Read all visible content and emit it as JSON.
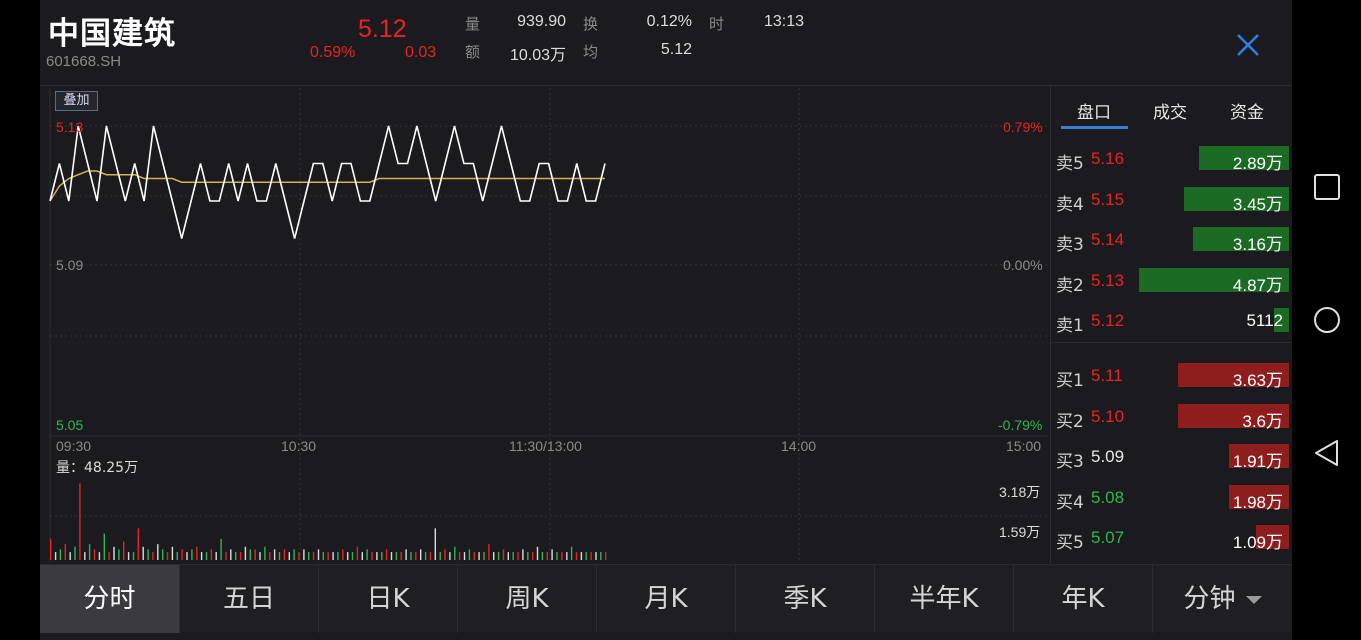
{
  "header": {
    "name": "中国建筑",
    "code": "601668.SH",
    "price": "5.12",
    "change_pct": "0.59%",
    "change": "0.03",
    "stats": [
      {
        "label": "量",
        "value": "939.90"
      },
      {
        "label": "换",
        "value": "0.12%"
      },
      {
        "label": "时",
        "value": "13:13"
      },
      {
        "label": "额",
        "value": "10.03万"
      },
      {
        "label": "均",
        "value": "5.12"
      }
    ]
  },
  "chart": {
    "overlay_label": "叠加",
    "price_high": "5.13",
    "price_mid": "5.09",
    "price_low": "5.05",
    "pct_high": "0.79%",
    "pct_mid": "0.00%",
    "pct_low": "-0.79%",
    "time_labels": [
      "09:30",
      "10:30",
      "11:30/13:00",
      "14:00",
      "15:00"
    ],
    "volume_label": "量：48.25万",
    "volume_axis_high": "3.18万",
    "volume_axis_mid": "1.59万",
    "colors": {
      "price_line": "#ffffff",
      "avg_line": "#d7b24a",
      "up": "#e8231f",
      "down": "#2fb84a"
    }
  },
  "chart_data": {
    "type": "line",
    "title": "",
    "xlabel": "",
    "ylabel": "",
    "ylim": [
      5.05,
      5.13
    ],
    "series": [
      {
        "values": [
          5.11,
          5.12,
          5.11,
          5.13,
          5.12,
          5.11,
          5.13,
          5.12,
          5.11,
          5.12,
          5.11,
          5.13,
          5.12,
          5.11,
          5.1,
          5.11,
          5.12,
          5.11,
          5.11,
          5.12,
          5.11,
          5.12,
          5.11,
          5.11,
          5.12,
          5.11,
          5.1,
          5.11,
          5.12,
          5.12,
          5.11,
          5.12,
          5.12,
          5.11,
          5.11,
          5.12,
          5.13,
          5.12,
          5.12,
          5.13,
          5.12,
          5.11,
          5.12,
          5.13,
          5.12,
          5.12,
          5.11,
          5.12,
          5.13,
          5.12,
          5.11,
          5.11,
          5.12,
          5.12,
          5.11,
          5.11,
          5.12,
          5.11,
          5.11,
          5.12
        ]
      },
      {
        "values": [
          5.11,
          5.114,
          5.116,
          5.117,
          5.118,
          5.118,
          5.117,
          5.117,
          5.117,
          5.117,
          5.116,
          5.116,
          5.116,
          5.116,
          5.115,
          5.115,
          5.115,
          5.115,
          5.115,
          5.115,
          5.115,
          5.115,
          5.115,
          5.115,
          5.115,
          5.115,
          5.115,
          5.115,
          5.115,
          5.115,
          5.115,
          5.115,
          5.115,
          5.115,
          5.115,
          5.116,
          5.116,
          5.116,
          5.116,
          5.116,
          5.116,
          5.116,
          5.116,
          5.116,
          5.116,
          5.116,
          5.116,
          5.116,
          5.116,
          5.116,
          5.116,
          5.116,
          5.116,
          5.116,
          5.116,
          5.116,
          5.116,
          5.116,
          5.116,
          5.116
        ]
      }
    ],
    "volume": [
      0.8,
      0.3,
      0.4,
      0.6,
      0.3,
      0.5,
      2.9,
      0.3,
      0.6,
      0.4,
      0.3,
      1.0,
      0.3,
      0.5,
      0.4,
      0.7,
      0.3,
      0.3,
      1.2,
      0.5,
      0.4,
      0.3,
      0.6,
      0.4,
      0.3,
      0.5,
      0.3,
      0.4,
      0.3,
      0.4,
      0.5,
      0.3,
      0.3,
      0.4,
      0.3,
      0.8,
      0.3,
      0.4,
      0.3,
      0.3,
      0.5,
      0.4,
      0.4,
      0.3,
      0.5,
      0.3,
      0.4,
      0.3,
      0.4,
      0.3,
      0.4,
      0.3,
      0.4,
      0.3,
      0.3,
      0.4,
      0.3,
      0.3,
      0.3,
      0.3,
      0.4,
      0.3,
      0.3,
      0.5,
      0.3,
      0.4,
      0.3,
      0.3,
      0.3,
      0.4,
      0.3,
      0.3,
      0.3,
      0.4,
      0.3,
      0.3,
      0.4,
      0.3,
      0.3,
      1.2,
      0.3,
      0.4,
      0.3,
      0.5,
      0.3,
      0.3,
      0.4,
      0.3,
      0.3,
      0.3,
      0.6,
      0.3,
      0.3,
      0.4,
      0.3,
      0.3,
      0.3,
      0.4,
      0.3,
      0.3,
      0.5,
      0.3,
      0.3,
      0.4,
      0.3,
      0.3,
      0.3,
      0.5,
      0.3,
      0.3,
      0.3,
      0.3,
      0.3,
      0.3,
      0.3
    ],
    "volume_ylim": [
      0,
      3.18
    ]
  },
  "book": {
    "tabs": [
      "盘口",
      "成交",
      "资金"
    ],
    "sells": [
      {
        "label": "卖5",
        "price": "5.16",
        "volume": "2.89万",
        "ratio": 0.3
      },
      {
        "label": "卖4",
        "price": "5.15",
        "volume": "3.45万",
        "ratio": 0.35
      },
      {
        "label": "卖3",
        "price": "5.14",
        "volume": "3.16万",
        "ratio": 0.32
      },
      {
        "label": "卖2",
        "price": "5.13",
        "volume": "4.87万",
        "ratio": 0.5
      },
      {
        "label": "卖1",
        "price": "5.12",
        "volume": "5112",
        "ratio": 0.05
      }
    ],
    "buys": [
      {
        "label": "买1",
        "price": "5.11",
        "volume": "3.63万",
        "ratio": 0.37
      },
      {
        "label": "买2",
        "price": "5.10",
        "volume": "3.6万",
        "ratio": 0.37
      },
      {
        "label": "买3",
        "price": "5.09",
        "volume": "1.91万",
        "ratio": 0.2
      },
      {
        "label": "买4",
        "price": "5.08",
        "volume": "1.98万",
        "ratio": 0.2
      },
      {
        "label": "买5",
        "price": "5.07",
        "volume": "1.09万",
        "ratio": 0.11
      }
    ]
  },
  "bottom_tabs": [
    "分时",
    "五日",
    "日K",
    "周K",
    "月K",
    "季K",
    "半年K",
    "年K",
    "分钟"
  ]
}
